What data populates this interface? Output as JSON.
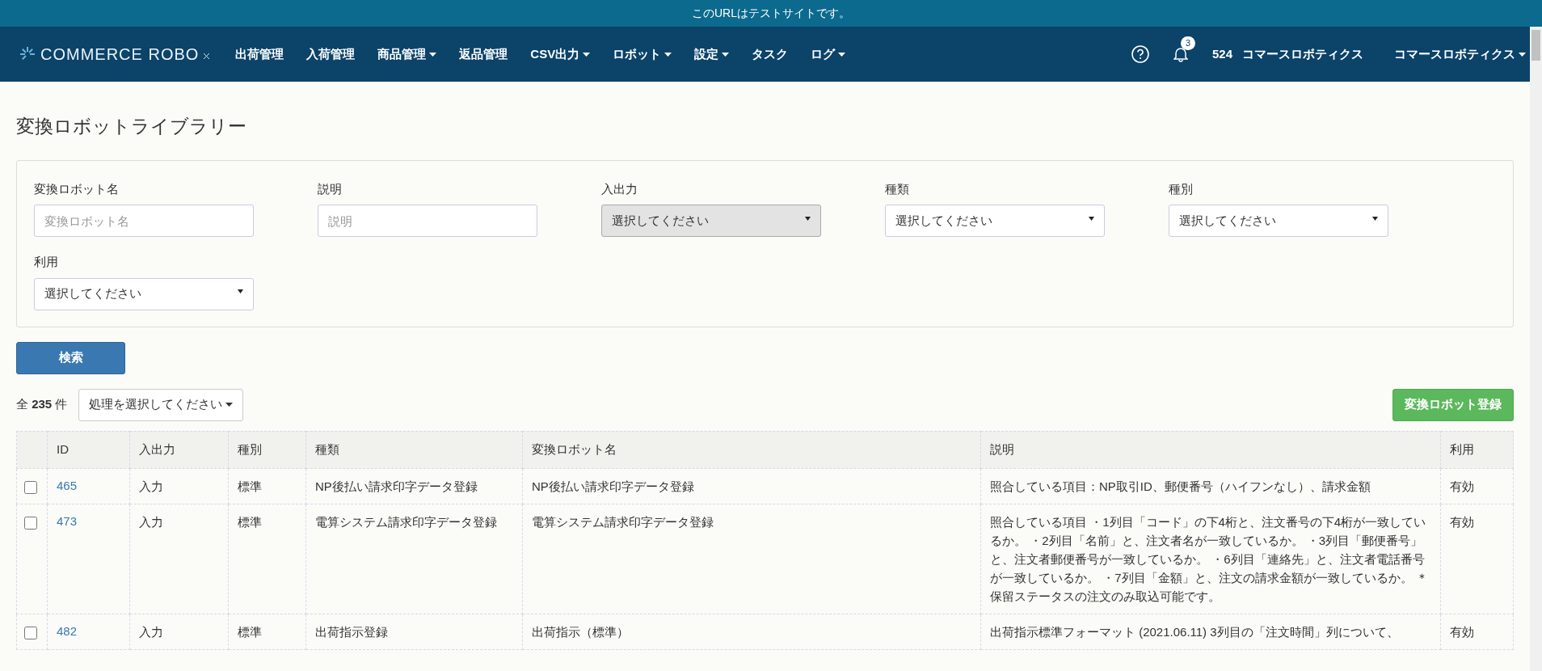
{
  "banner": "このURLはテストサイトです。",
  "navbar": {
    "logo": "COMMERCE ROBO",
    "items": [
      {
        "label": "出荷管理",
        "dropdown": false
      },
      {
        "label": "入荷管理",
        "dropdown": false
      },
      {
        "label": "商品管理",
        "dropdown": true
      },
      {
        "label": "返品管理",
        "dropdown": false
      },
      {
        "label": "CSV出力",
        "dropdown": true
      },
      {
        "label": "ロボット",
        "dropdown": true
      },
      {
        "label": "設定",
        "dropdown": true
      },
      {
        "label": "タスク",
        "dropdown": false
      },
      {
        "label": "ログ",
        "dropdown": true
      }
    ],
    "notification_count": "3",
    "account_id": "524",
    "company": "コマースロボティクス",
    "user_menu": "コマースロボティクス"
  },
  "page_title": "変換ロボットライブラリー",
  "filters": [
    {
      "kind": "text",
      "label": "変換ロボット名",
      "placeholder": "変換ロボット名"
    },
    {
      "kind": "text",
      "label": "説明",
      "placeholder": "説明"
    },
    {
      "kind": "select",
      "label": "入出力",
      "value": "選択してください",
      "hovered": true
    },
    {
      "kind": "select",
      "label": "種類",
      "value": "選択してください",
      "hovered": false
    },
    {
      "kind": "select",
      "label": "種別",
      "value": "選択してください",
      "hovered": false
    },
    {
      "kind": "select",
      "label": "利用",
      "value": "選択してください",
      "hovered": false
    }
  ],
  "search_button": "検索",
  "total": {
    "prefix": "全",
    "count": "235",
    "suffix": "件"
  },
  "bulk_action": "処理を選択してください",
  "register_button": "変換ロボット登録",
  "table": {
    "columns": [
      "ID",
      "入出力",
      "種別",
      "種類",
      "変換ロボット名",
      "説明",
      "利用"
    ],
    "rows": [
      {
        "checked": false,
        "id": "465",
        "io": "入力",
        "category": "標準",
        "type": "NP後払い請求印字データ登録",
        "name": "NP後払い請求印字データ登録",
        "description": "照合している項目：NP取引ID、郵便番号（ハイフンなし）、請求金額",
        "usage": "有効"
      },
      {
        "checked": false,
        "id": "473",
        "io": "入力",
        "category": "標準",
        "type": "電算システム請求印字データ登録",
        "name": "電算システム請求印字データ登録",
        "description": "照合している項目 ・1列目「コード」の下4桁と、注文番号の下4桁が一致しているか。 ・2列目「名前」と、注文者名が一致しているか。 ・3列目「郵便番号」と、注文者郵便番号が一致しているか。 ・6列目「連絡先」と、注文者電話番号が一致しているか。 ・7列目「金額」と、注文の請求金額が一致しているか。 ＊保留ステータスの注文のみ取込可能です。",
        "usage": "有効"
      },
      {
        "checked": false,
        "id": "482",
        "io": "入力",
        "category": "標準",
        "type": "出荷指示登録",
        "name": "出荷指示（標準）",
        "description": "出荷指示標準フォーマット (2021.06.11) 3列目の「注文時間」列について、",
        "usage": "有効"
      }
    ]
  }
}
